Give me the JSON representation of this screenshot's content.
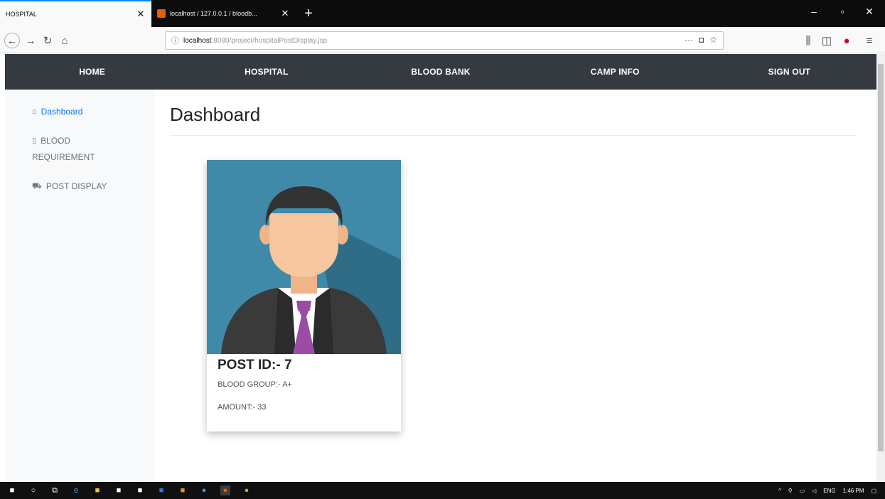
{
  "browser": {
    "active_tab_title": "HOSPITAL",
    "inactive_tab_title": "localhost / 127.0.0.1 / bloodb...",
    "url_host": "localhost",
    "url_path": ":8080/project/hospitalPostDisplay.jsp",
    "new_tab_icon": "plus-icon"
  },
  "navbar": {
    "items": [
      {
        "label": "HOME"
      },
      {
        "label": "HOSPITAL"
      },
      {
        "label": "BLOOD BANK"
      },
      {
        "label": "CAMP INFO"
      },
      {
        "label": "SIGN OUT"
      }
    ]
  },
  "sidebar": {
    "items": [
      {
        "label": "Dashboard",
        "icon": "home-icon"
      },
      {
        "label_line1": "BLOOD",
        "label_line2": "REQUIREMENT",
        "icon": "file-icon"
      },
      {
        "label": "POST DISPLAY",
        "icon": "cart-icon"
      }
    ]
  },
  "main": {
    "title": "Dashboard"
  },
  "card": {
    "title": "POST ID:- 7",
    "blood_group": "BLOOD GROUP:- A+",
    "amount": "AMOUNT:- 33"
  },
  "taskbar": {
    "lang": "ENG",
    "time": "1:46 PM"
  },
  "colors": {
    "navbar_bg": "#343a40",
    "sidebar_active": "#007bff",
    "avatar_bg": "#3f8aa8",
    "tie": "#9b4da6"
  }
}
